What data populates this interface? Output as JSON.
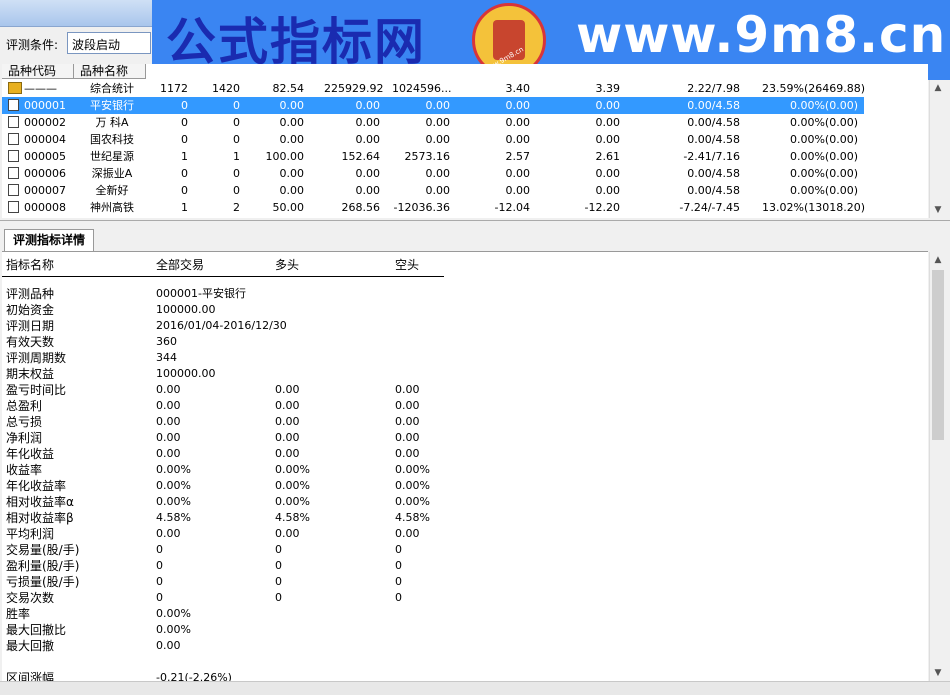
{
  "condition": {
    "label": "评测条件:",
    "value": "波段启动"
  },
  "watermark": {
    "cn": "公式指标网",
    "en": "www.9m8.cn",
    "logo_small": "www.9m8.cn"
  },
  "grid": {
    "headers": [
      "品种代码",
      "品种名称"
    ],
    "rows": [
      {
        "icon": "summary-icon",
        "code": "———",
        "name": "综合统计",
        "v": [
          "1172",
          "1420",
          "82.54",
          "225929.92",
          "1024596...",
          "3.40",
          "3.39",
          "2.22/7.98",
          "23.59%(26469.88)"
        ]
      },
      {
        "icon": "document-icon",
        "code": "000001",
        "name": "平安银行",
        "selected": true,
        "v": [
          "0",
          "0",
          "0.00",
          "0.00",
          "0.00",
          "0.00",
          "0.00",
          "0.00/4.58",
          "0.00%(0.00)"
        ]
      },
      {
        "icon": "document-icon",
        "code": "000002",
        "name": "万 科A",
        "v": [
          "0",
          "0",
          "0.00",
          "0.00",
          "0.00",
          "0.00",
          "0.00",
          "0.00/4.58",
          "0.00%(0.00)"
        ]
      },
      {
        "icon": "document-icon",
        "code": "000004",
        "name": "国农科技",
        "v": [
          "0",
          "0",
          "0.00",
          "0.00",
          "0.00",
          "0.00",
          "0.00",
          "0.00/4.58",
          "0.00%(0.00)"
        ]
      },
      {
        "icon": "document-icon",
        "code": "000005",
        "name": "世纪星源",
        "v": [
          "1",
          "1",
          "100.00",
          "152.64",
          "2573.16",
          "2.57",
          "2.61",
          "-2.41/7.16",
          "0.00%(0.00)"
        ]
      },
      {
        "icon": "document-icon",
        "code": "000006",
        "name": "深振业A",
        "v": [
          "0",
          "0",
          "0.00",
          "0.00",
          "0.00",
          "0.00",
          "0.00",
          "0.00/4.58",
          "0.00%(0.00)"
        ]
      },
      {
        "icon": "document-icon",
        "code": "000007",
        "name": "全新好",
        "v": [
          "0",
          "0",
          "0.00",
          "0.00",
          "0.00",
          "0.00",
          "0.00",
          "0.00/4.58",
          "0.00%(0.00)"
        ]
      },
      {
        "icon": "document-icon",
        "code": "000008",
        "name": "神州高铁",
        "v": [
          "1",
          "2",
          "50.00",
          "268.56",
          "-12036.36",
          "-12.04",
          "-12.20",
          "-7.24/-7.45",
          "13.02%(13018.20)"
        ]
      }
    ]
  },
  "tab": {
    "label": "评测指标详情"
  },
  "detail": {
    "headers": [
      "指标名称",
      "全部交易",
      "多头",
      "空头"
    ],
    "rows": [
      {
        "label": "评测品种",
        "all": "000001-平安银行",
        "long": "",
        "short": ""
      },
      {
        "label": "初始资金",
        "all": "100000.00",
        "long": "",
        "short": ""
      },
      {
        "label": "评测日期",
        "all": "2016/01/04-2016/12/30",
        "long": "",
        "short": ""
      },
      {
        "label": "有效天数",
        "all": "360",
        "long": "",
        "short": ""
      },
      {
        "label": "评测周期数",
        "all": "344",
        "long": "",
        "short": ""
      },
      {
        "label": "期末权益",
        "all": "100000.00",
        "long": "",
        "short": ""
      },
      {
        "label": "盈亏时间比",
        "all": "0.00",
        "long": "0.00",
        "short": "0.00"
      },
      {
        "label": "总盈利",
        "all": "0.00",
        "long": "0.00",
        "short": "0.00"
      },
      {
        "label": "总亏损",
        "all": "0.00",
        "long": "0.00",
        "short": "0.00"
      },
      {
        "label": "净利润",
        "all": "0.00",
        "long": "0.00",
        "short": "0.00"
      },
      {
        "label": "年化收益",
        "all": "0.00",
        "long": "0.00",
        "short": "0.00"
      },
      {
        "label": "收益率",
        "all": "0.00%",
        "long": "0.00%",
        "short": "0.00%"
      },
      {
        "label": "年化收益率",
        "all": "0.00%",
        "long": "0.00%",
        "short": "0.00%"
      },
      {
        "label": "相对收益率α",
        "all": "0.00%",
        "long": "0.00%",
        "short": "0.00%"
      },
      {
        "label": "相对收益率β",
        "all": "4.58%",
        "long": "4.58%",
        "short": "4.58%"
      },
      {
        "label": "平均利润",
        "all": "0.00",
        "long": "0.00",
        "short": "0.00"
      },
      {
        "label": "交易量(股/手)",
        "all": "0",
        "long": "0",
        "short": "0"
      },
      {
        "label": "盈利量(股/手)",
        "all": "0",
        "long": "0",
        "short": "0"
      },
      {
        "label": "亏损量(股/手)",
        "all": "0",
        "long": "0",
        "short": "0"
      },
      {
        "label": "交易次数",
        "all": "0",
        "long": "0",
        "short": "0"
      },
      {
        "label": "胜率",
        "all": "0.00%",
        "long": "",
        "short": ""
      },
      {
        "label": "最大回撤比",
        "all": "0.00%",
        "long": "",
        "short": ""
      },
      {
        "label": "最大回撤",
        "all": "0.00",
        "long": "",
        "short": ""
      },
      {
        "label": "",
        "all": "",
        "long": "",
        "short": ""
      },
      {
        "label": "区间涨幅",
        "all": "-0.21(-2.26%)",
        "long": "",
        "short": ""
      }
    ]
  }
}
